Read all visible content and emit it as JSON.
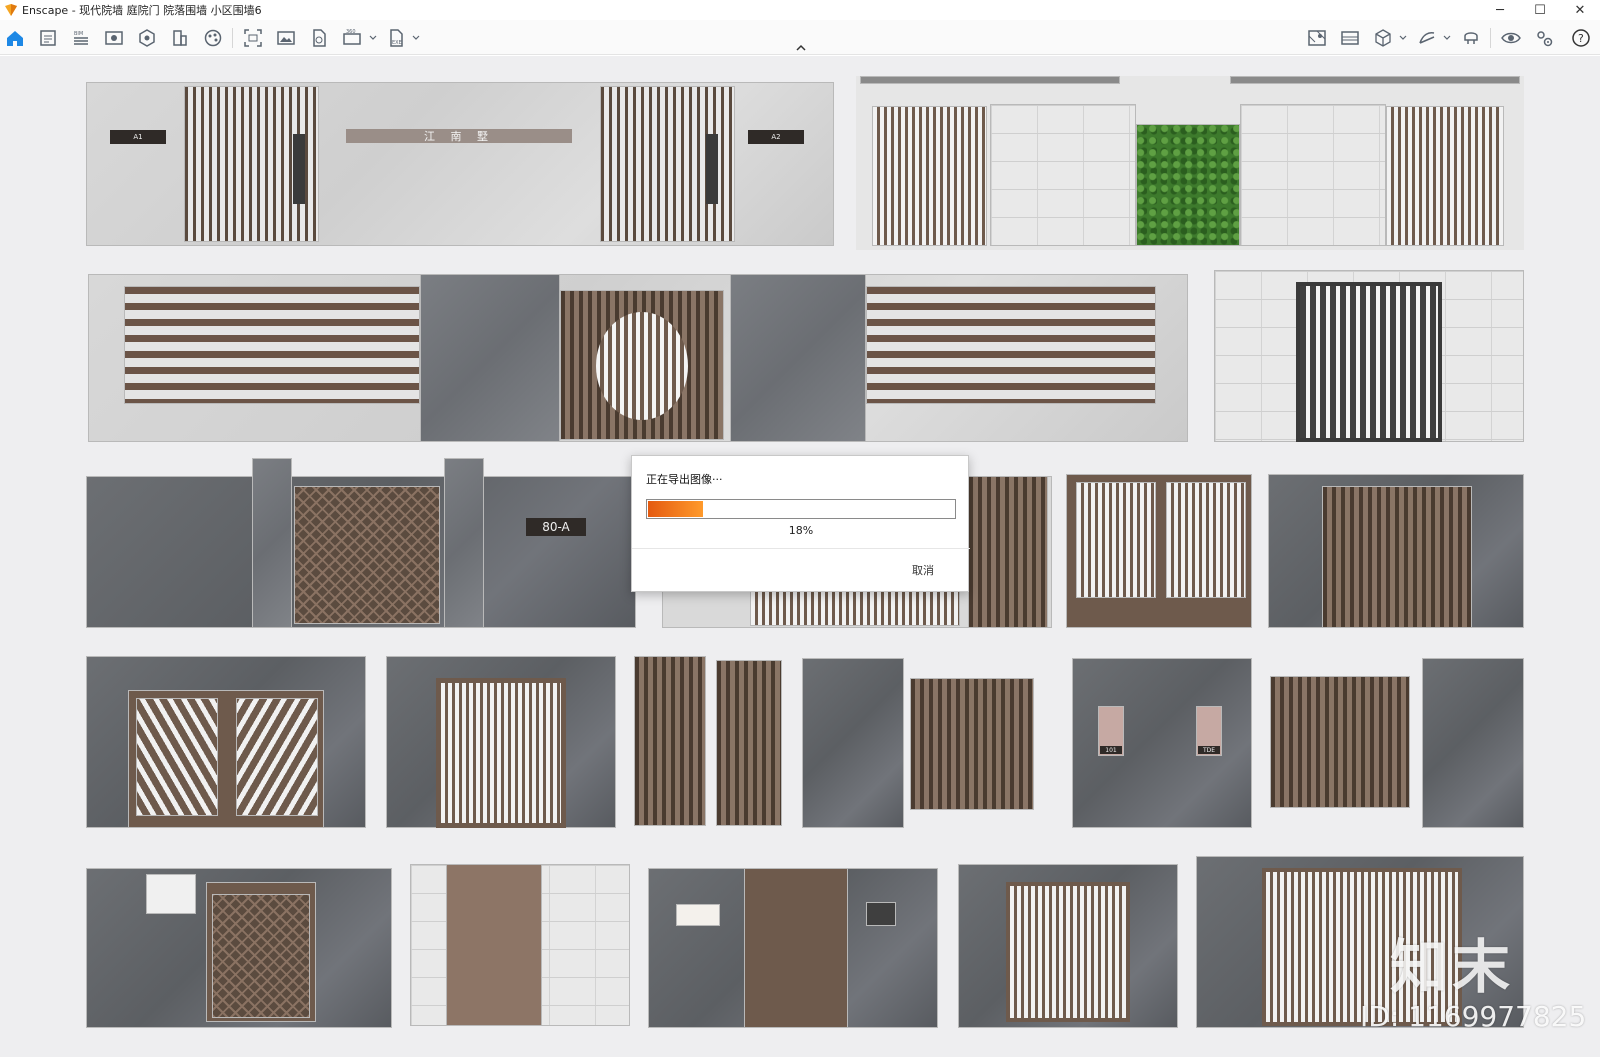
{
  "window": {
    "title": "Enscape - 现代院墙 庭院门 院落围墙 小区围墙6",
    "minimize": "─",
    "maximize": "☐",
    "close": "✕"
  },
  "toolbar": {
    "left_icons": [
      "home-icon",
      "project-info-icon",
      "bim-icon",
      "view-icon",
      "visual-settings-icon",
      "site-context-icon",
      "material-editor-icon",
      "asset-library-icon",
      "screenshot-icon",
      "batch-render-icon",
      "export-panorama-icon",
      "render-360-icon",
      "export-exe-icon"
    ],
    "right_icons": [
      "map-icon",
      "image-gallery-icon",
      "cube-view-icon",
      "sketch-icon",
      "vr-headset-icon",
      "live-view-icon",
      "settings-icon",
      "help-icon"
    ]
  },
  "scene": {
    "signs": {
      "row1_left_name": "江 南 墅",
      "row1_tag_a1": "A1",
      "row1_tag_a2": "A2",
      "row3_plate": "80-A",
      "row4_unit1": "101",
      "row4_unit2": "TDE"
    }
  },
  "watermark": {
    "brand": "知末",
    "id": "ID: 1169977825"
  },
  "dialog": {
    "title": "正在导出图像···",
    "progress": 0.18,
    "progress_text": "18%",
    "cancel_label": "取消"
  },
  "colors": {
    "accent": "#f07d1a",
    "toolbar_icon": "#5a6470",
    "home_icon": "#1e88e5"
  }
}
